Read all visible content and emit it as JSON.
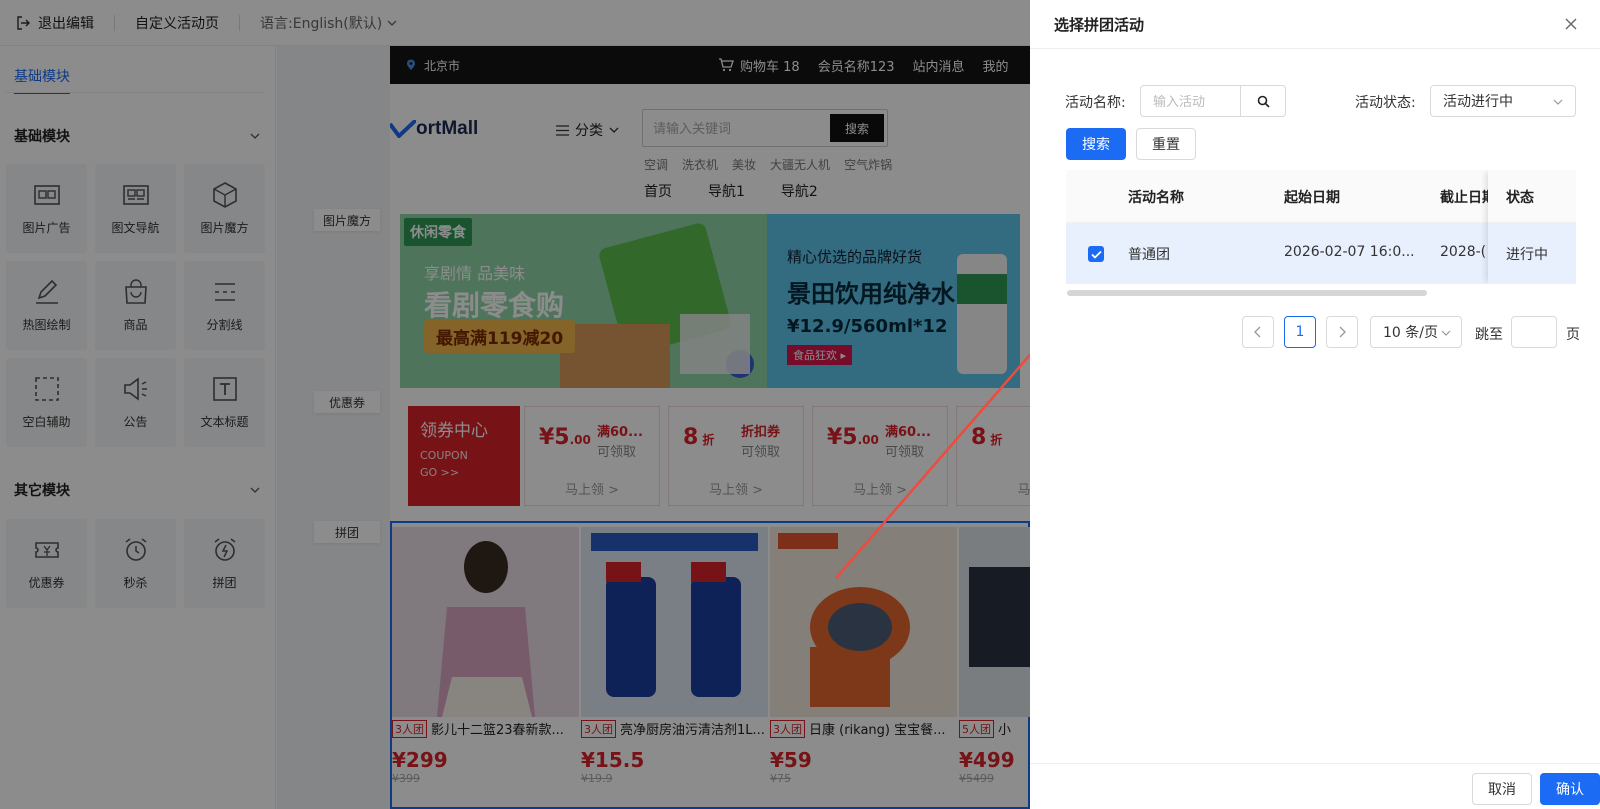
{
  "topbar": {
    "exit_label": "退出编辑",
    "page_label": "自定义活动页",
    "lang_label": "语言:",
    "lang_value": "English(默认)"
  },
  "left_panel": {
    "tab": "基础模块",
    "section_basic": "基础模块",
    "basic_items": [
      {
        "label": "图片广告",
        "icon": "image-ad-icon"
      },
      {
        "label": "图文导航",
        "icon": "text-nav-icon"
      },
      {
        "label": "图片魔方",
        "icon": "cube-icon"
      },
      {
        "label": "热图绘制",
        "icon": "pen-icon"
      },
      {
        "label": "商品",
        "icon": "bag-icon"
      },
      {
        "label": "分割线",
        "icon": "divider-icon"
      },
      {
        "label": "空白辅助",
        "icon": "blank-icon"
      },
      {
        "label": "公告",
        "icon": "speaker-icon"
      },
      {
        "label": "文本标题",
        "icon": "text-title-icon"
      }
    ],
    "section_other": "其它模块",
    "other_items": [
      {
        "label": "优惠券",
        "icon": "coupon-icon"
      },
      {
        "label": "秒杀",
        "icon": "alarm-clock-icon"
      },
      {
        "label": "拼团",
        "icon": "flash-clock-icon"
      }
    ]
  },
  "canvas": {
    "side_labels": [
      "图片魔方",
      "优惠券",
      "拼团"
    ]
  },
  "preview": {
    "city": "北京市",
    "cart": "购物车 18",
    "member": "会员名称123",
    "messages": "站内消息",
    "mine": "我的",
    "logo": "ortMall",
    "category": "分类",
    "search_placeholder": "请输入关键词",
    "search_btn": "搜索",
    "hotwords": [
      "空调",
      "洗衣机",
      "美妆",
      "大疆无人机",
      "空气炸锅"
    ],
    "navs": [
      "首页",
      "导航1",
      "导航2"
    ],
    "banner1": {
      "tag": "休闲零食",
      "sub": "享剧情 品美味",
      "title": "看剧零食购",
      "promo": "最高满119减20"
    },
    "banner2": {
      "sub": "精心优选的品牌好货",
      "title": "景田饮用纯净水",
      "price": "¥12.9/560ml*12",
      "badge": "食品狂欢 ▸"
    },
    "coupon_center": {
      "title": "领券中心",
      "en": "COUPON",
      "go": "GO >>"
    },
    "coupons": [
      {
        "amount": "¥5",
        "decimal": ".00",
        "cond": "满60...",
        "get": "可领取",
        "go": "马上领 >"
      },
      {
        "amount": "8",
        "decimal": "折",
        "cond": "折扣券",
        "get": "可领取",
        "go": "马上领 >"
      },
      {
        "amount": "¥5",
        "decimal": ".00",
        "cond": "满60...",
        "get": "可领取",
        "go": "马上领 >"
      },
      {
        "amount": "8",
        "decimal": "折",
        "cond": "",
        "get": "",
        "go": "马"
      }
    ],
    "products": [
      {
        "badge": "3人团",
        "name": "影儿十二篮23春新款...",
        "price": "¥299",
        "orig": "¥399",
        "color": "#e9dde4"
      },
      {
        "badge": "3人团",
        "name": "亮净厨房油污清洁剂1L...",
        "price": "¥15.5",
        "orig": "¥19.9",
        "color": "#dfe6f2"
      },
      {
        "badge": "3人团",
        "name": "日康 (rikang) 宝宝餐...",
        "price": "¥59",
        "orig": "¥75",
        "color": "#f2e8dc"
      },
      {
        "badge": "5人团",
        "name": "小",
        "price": "¥499",
        "orig": "¥5499",
        "color": "#dfe3ea"
      }
    ]
  },
  "drawer": {
    "title": "选择拼团活动",
    "name_label": "活动名称:",
    "name_placeholder": "输入活动",
    "status_label": "活动状态:",
    "status_value": "活动进行中",
    "search_btn": "搜索",
    "reset_btn": "重置",
    "columns": [
      "活动名称",
      "起始日期",
      "截止日期",
      "状态"
    ],
    "rows": [
      {
        "checked": true,
        "name": "普通团",
        "start": "2026-02-07 16:0...",
        "end": "2028-(",
        "status": "进行中"
      }
    ],
    "pagination": {
      "current": "1",
      "page_size": "10 条/页",
      "jump_label": "跳至",
      "page_unit": "页"
    },
    "cancel_btn": "取消",
    "confirm_btn": "确认"
  },
  "colors": {
    "primary": "#1b6bf5",
    "price_red": "#d92228",
    "arrow": "#ee4b3c"
  }
}
